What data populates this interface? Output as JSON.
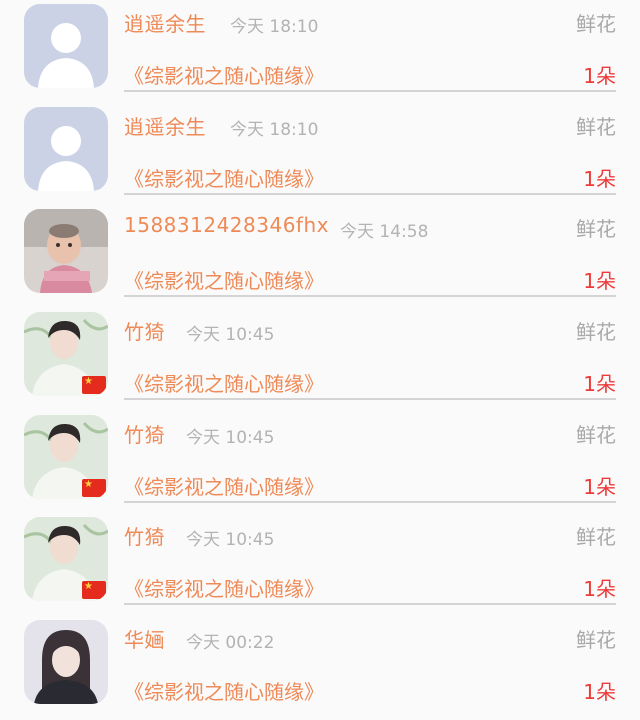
{
  "rows": [
    {
      "avatar": "default-avatar",
      "name": "逍遥余生",
      "time": "今天 18:10",
      "gift": "鲜花",
      "work": "《综影视之随心随缘》",
      "count": "1朵"
    },
    {
      "avatar": "default-avatar",
      "name": "逍遥余生",
      "time": "今天 18:10",
      "gift": "鲜花",
      "work": "《综影视之随心随缘》",
      "count": "1朵"
    },
    {
      "avatar": "baby-photo",
      "name": "1588312428346fhx",
      "time": "今天 14:58",
      "gift": "鲜花",
      "work": "《综影视之随心随缘》",
      "count": "1朵"
    },
    {
      "avatar": "man-portrait-flag",
      "name": "竹猗",
      "time": "今天 10:45",
      "gift": "鲜花",
      "work": "《综影视之随心随缘》",
      "count": "1朵"
    },
    {
      "avatar": "man-portrait-flag",
      "name": "竹猗",
      "time": "今天 10:45",
      "gift": "鲜花",
      "work": "《综影视之随心随缘》",
      "count": "1朵"
    },
    {
      "avatar": "man-portrait-flag",
      "name": "竹猗",
      "time": "今天 10:45",
      "gift": "鲜花",
      "work": "《综影视之随心随缘》",
      "count": "1朵"
    },
    {
      "avatar": "woman-portrait",
      "name": "华婳",
      "time": "今天 00:22",
      "gift": "鲜花",
      "work": "《综影视之随心随缘》",
      "count": "1朵"
    }
  ],
  "colors": {
    "accent": "#ee8a57",
    "count": "#ee3a3a",
    "muted": "#b3b3b3",
    "background": "#fafafa"
  }
}
